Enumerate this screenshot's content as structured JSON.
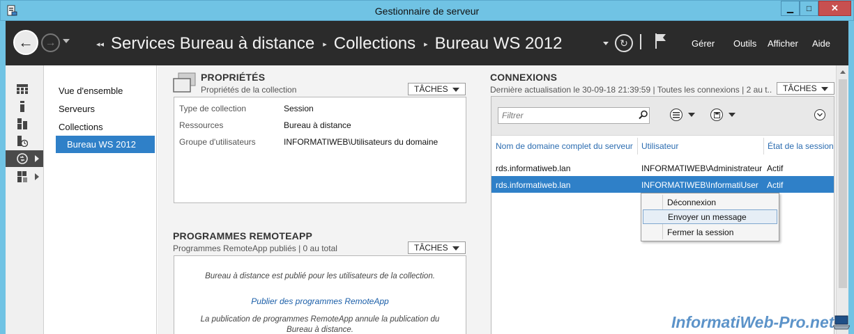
{
  "window": {
    "title": "Gestionnaire de serveur",
    "minimize_glyph": "▁",
    "maximize_glyph": "□",
    "close_glyph": "✕"
  },
  "header": {
    "breadcrumb": [
      "Services Bureau à distance",
      "Collections",
      "Bureau WS 2012"
    ],
    "breadcrumb_sep_first": "◂◂",
    "breadcrumb_sep": "▸",
    "menu": {
      "manage": "Gérer",
      "tools": "Outils",
      "view": "Afficher",
      "help": "Aide"
    },
    "back_glyph": "←",
    "forward_glyph": "→",
    "refresh_glyph": "↻"
  },
  "rail": {
    "icons": [
      "dashboard-icon",
      "local-server-icon",
      "all-servers-icon",
      "file-services-icon",
      "remote-desktop-icon",
      "storage-icon"
    ]
  },
  "nav": {
    "items": [
      "Vue d'ensemble",
      "Serveurs",
      "Collections"
    ],
    "active": "Bureau WS 2012"
  },
  "properties": {
    "title": "PROPRIÉTÉS",
    "subtitle": "Propriétés de la collection",
    "tasks_label": "TÂCHES",
    "rows": [
      {
        "label": "Type de collection",
        "value": "Session"
      },
      {
        "label": "Ressources",
        "value": "Bureau à distance"
      },
      {
        "label": "Groupe d'utilisateurs",
        "value": "INFORMATIWEB\\Utilisateurs du domaine"
      }
    ]
  },
  "remoteapp": {
    "title": "PROGRAMMES REMOTEAPP",
    "subtitle": "Programmes RemoteApp publiés | 0 au total",
    "tasks_label": "TÂCHES",
    "message": "Bureau à distance est publié pour les utilisateurs de la collection.",
    "link": "Publier des programmes RemoteApp",
    "note_line1": "La publication de programmes RemoteApp annule la publication du",
    "note_line2": "Bureau à distance."
  },
  "connections": {
    "title": "CONNEXIONS",
    "subtitle": "Dernière actualisation le 30-09-18 21:39:59 | Toutes les connexions | 2 au t...",
    "tasks_label": "TÂCHES",
    "filter_placeholder": "Filtrer",
    "columns": [
      "Nom de domaine complet du serveur",
      "Utilisateur",
      "État de la session"
    ],
    "rows": [
      {
        "server": "rds.informatiweb.lan",
        "user": "INFORMATIWEB\\Administrateur",
        "state": "Actif",
        "selected": false
      },
      {
        "server": "rds.informatiweb.lan",
        "user": "INFORMATIWEB\\InformatiUser",
        "state": "Actif",
        "selected": true
      }
    ]
  },
  "context_menu": {
    "items": [
      "Déconnexion",
      "Envoyer un message",
      "Fermer la session"
    ],
    "hovered": "Envoyer un message"
  },
  "watermark": "InformatiWeb-Pro.net",
  "colors": {
    "titlebar": "#70c3e4",
    "header": "#2b2b2b",
    "selection": "#2f80c8",
    "link": "#1a5ea8"
  }
}
